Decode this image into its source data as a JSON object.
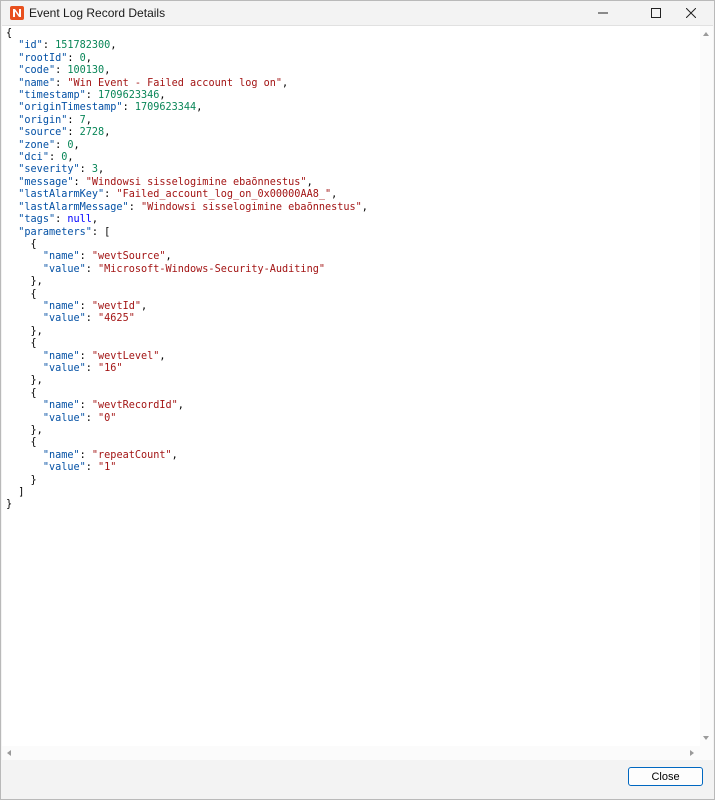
{
  "window": {
    "title": "Event Log Record Details",
    "icon": "netxms-logo-icon",
    "controls": [
      "minimize-icon",
      "maximize-icon",
      "close-icon"
    ]
  },
  "json_viewer": {
    "lines": [
      [
        [
          "p",
          "{"
        ]
      ],
      [
        [
          "p",
          "  "
        ],
        [
          "k",
          "\"id\""
        ],
        [
          "p",
          ": "
        ],
        [
          "n",
          "151782300"
        ],
        [
          "p",
          ","
        ]
      ],
      [
        [
          "p",
          "  "
        ],
        [
          "k",
          "\"rootId\""
        ],
        [
          "p",
          ": "
        ],
        [
          "n",
          "0"
        ],
        [
          "p",
          ","
        ]
      ],
      [
        [
          "p",
          "  "
        ],
        [
          "k",
          "\"code\""
        ],
        [
          "p",
          ": "
        ],
        [
          "n",
          "100130"
        ],
        [
          "p",
          ","
        ]
      ],
      [
        [
          "p",
          "  "
        ],
        [
          "k",
          "\"name\""
        ],
        [
          "p",
          ": "
        ],
        [
          "s",
          "\"Win Event - Failed account log on\""
        ],
        [
          "p",
          ","
        ]
      ],
      [
        [
          "p",
          "  "
        ],
        [
          "k",
          "\"timestamp\""
        ],
        [
          "p",
          ": "
        ],
        [
          "n",
          "1709623346"
        ],
        [
          "p",
          ","
        ]
      ],
      [
        [
          "p",
          "  "
        ],
        [
          "k",
          "\"originTimestamp\""
        ],
        [
          "p",
          ": "
        ],
        [
          "n",
          "1709623344"
        ],
        [
          "p",
          ","
        ]
      ],
      [
        [
          "p",
          "  "
        ],
        [
          "k",
          "\"origin\""
        ],
        [
          "p",
          ": "
        ],
        [
          "n",
          "7"
        ],
        [
          "p",
          ","
        ]
      ],
      [
        [
          "p",
          "  "
        ],
        [
          "k",
          "\"source\""
        ],
        [
          "p",
          ": "
        ],
        [
          "n",
          "2728"
        ],
        [
          "p",
          ","
        ]
      ],
      [
        [
          "p",
          "  "
        ],
        [
          "k",
          "\"zone\""
        ],
        [
          "p",
          ": "
        ],
        [
          "n",
          "0"
        ],
        [
          "p",
          ","
        ]
      ],
      [
        [
          "p",
          "  "
        ],
        [
          "k",
          "\"dci\""
        ],
        [
          "p",
          ": "
        ],
        [
          "n",
          "0"
        ],
        [
          "p",
          ","
        ]
      ],
      [
        [
          "p",
          "  "
        ],
        [
          "k",
          "\"severity\""
        ],
        [
          "p",
          ": "
        ],
        [
          "n",
          "3"
        ],
        [
          "p",
          ","
        ]
      ],
      [
        [
          "p",
          "  "
        ],
        [
          "k",
          "\"message\""
        ],
        [
          "p",
          ": "
        ],
        [
          "s",
          "\"Windowsi sisselogimine ebaõnnestus\""
        ],
        [
          "p",
          ","
        ]
      ],
      [
        [
          "p",
          "  "
        ],
        [
          "k",
          "\"lastAlarmKey\""
        ],
        [
          "p",
          ": "
        ],
        [
          "s",
          "\"Failed_account_log_on_0x00000AA8_\""
        ],
        [
          "p",
          ","
        ]
      ],
      [
        [
          "p",
          "  "
        ],
        [
          "k",
          "\"lastAlarmMessage\""
        ],
        [
          "p",
          ": "
        ],
        [
          "s",
          "\"Windowsi sisselogimine ebaõnnestus\""
        ],
        [
          "p",
          ","
        ]
      ],
      [
        [
          "p",
          "  "
        ],
        [
          "k",
          "\"tags\""
        ],
        [
          "p",
          ": "
        ],
        [
          "kw",
          "null"
        ],
        [
          "p",
          ","
        ]
      ],
      [
        [
          "p",
          "  "
        ],
        [
          "k",
          "\"parameters\""
        ],
        [
          "p",
          ": ["
        ]
      ],
      [
        [
          "p",
          "    {"
        ]
      ],
      [
        [
          "p",
          "      "
        ],
        [
          "k",
          "\"name\""
        ],
        [
          "p",
          ": "
        ],
        [
          "s",
          "\"wevtSource\""
        ],
        [
          "p",
          ","
        ]
      ],
      [
        [
          "p",
          "      "
        ],
        [
          "k",
          "\"value\""
        ],
        [
          "p",
          ": "
        ],
        [
          "s",
          "\"Microsoft-Windows-Security-Auditing\""
        ]
      ],
      [
        [
          "p",
          "    },"
        ]
      ],
      [
        [
          "p",
          "    {"
        ]
      ],
      [
        [
          "p",
          "      "
        ],
        [
          "k",
          "\"name\""
        ],
        [
          "p",
          ": "
        ],
        [
          "s",
          "\"wevtId\""
        ],
        [
          "p",
          ","
        ]
      ],
      [
        [
          "p",
          "      "
        ],
        [
          "k",
          "\"value\""
        ],
        [
          "p",
          ": "
        ],
        [
          "s",
          "\"4625\""
        ]
      ],
      [
        [
          "p",
          "    },"
        ]
      ],
      [
        [
          "p",
          "    {"
        ]
      ],
      [
        [
          "p",
          "      "
        ],
        [
          "k",
          "\"name\""
        ],
        [
          "p",
          ": "
        ],
        [
          "s",
          "\"wevtLevel\""
        ],
        [
          "p",
          ","
        ]
      ],
      [
        [
          "p",
          "      "
        ],
        [
          "k",
          "\"value\""
        ],
        [
          "p",
          ": "
        ],
        [
          "s",
          "\"16\""
        ]
      ],
      [
        [
          "p",
          "    },"
        ]
      ],
      [
        [
          "p",
          "    {"
        ]
      ],
      [
        [
          "p",
          "      "
        ],
        [
          "k",
          "\"name\""
        ],
        [
          "p",
          ": "
        ],
        [
          "s",
          "\"wevtRecordId\""
        ],
        [
          "p",
          ","
        ]
      ],
      [
        [
          "p",
          "      "
        ],
        [
          "k",
          "\"value\""
        ],
        [
          "p",
          ": "
        ],
        [
          "s",
          "\"0\""
        ]
      ],
      [
        [
          "p",
          "    },"
        ]
      ],
      [
        [
          "p",
          "    {"
        ]
      ],
      [
        [
          "p",
          "      "
        ],
        [
          "k",
          "\"name\""
        ],
        [
          "p",
          ": "
        ],
        [
          "s",
          "\"repeatCount\""
        ],
        [
          "p",
          ","
        ]
      ],
      [
        [
          "p",
          "      "
        ],
        [
          "k",
          "\"value\""
        ],
        [
          "p",
          ": "
        ],
        [
          "s",
          "\"1\""
        ]
      ],
      [
        [
          "p",
          "    }"
        ]
      ],
      [
        [
          "p",
          "  ]"
        ]
      ],
      [
        [
          "p",
          "}"
        ]
      ]
    ]
  },
  "colors": {
    "key": "#0451a5",
    "string": "#a31515",
    "number": "#098658",
    "keyword": "#0000ff",
    "primary_button_border": "#0067c0"
  },
  "footer": {
    "close_label": "Close"
  }
}
